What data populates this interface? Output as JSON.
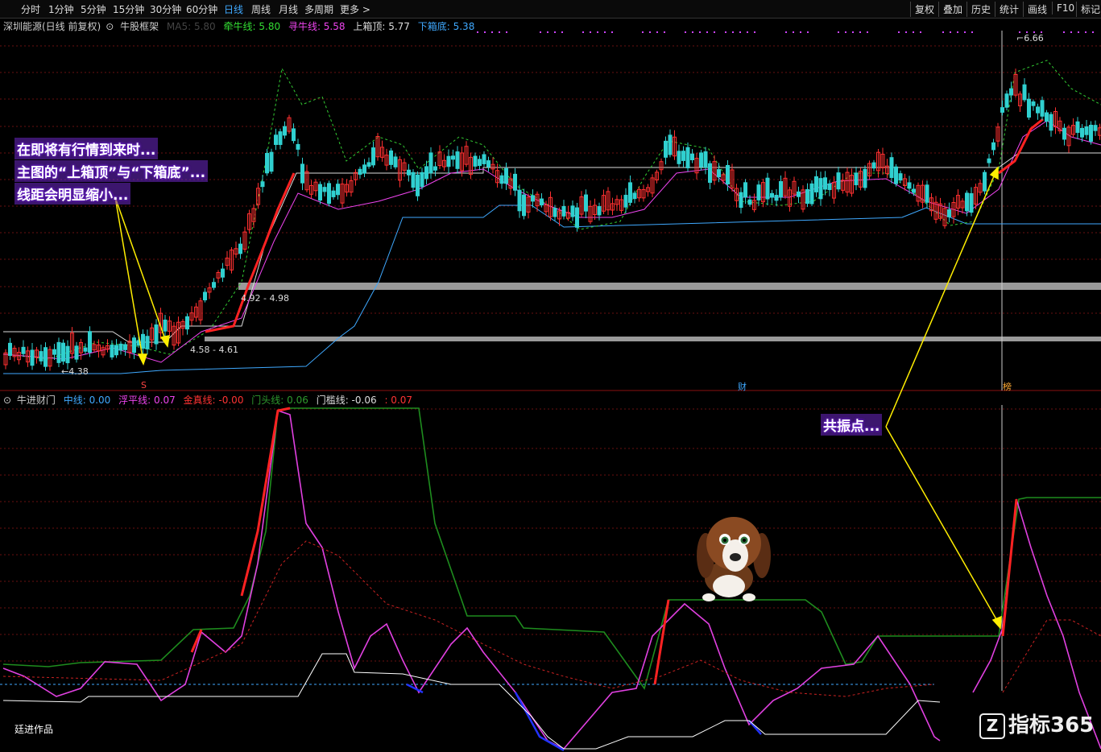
{
  "toolbar": {
    "periods": [
      "分时",
      "1分钟",
      "5分钟",
      "15分钟",
      "30分钟",
      "60分钟",
      "日线",
      "周线",
      "月线",
      "多周期",
      "更多 >"
    ],
    "active": "日线",
    "right": [
      "复权",
      "叠加",
      "历史",
      "统计",
      "画线",
      "F10",
      "标记"
    ]
  },
  "main_legend": {
    "stock": "深圳能源(日线 前复权)",
    "indicator": "牛股框架",
    "items": [
      {
        "label": "MA5: 5.80",
        "color": "#444444"
      },
      {
        "label": "牵牛线: 5.80",
        "color": "#33dd33"
      },
      {
        "label": "寻牛线: 5.58",
        "color": "#ee44ee"
      },
      {
        "label": "上箱顶: 5.77",
        "color": "#dddddd"
      },
      {
        "label": "下箱底: 5.38",
        "color": "#3fa9ff"
      }
    ]
  },
  "sub_legend": {
    "indicator": "牛进财门",
    "items": [
      {
        "label": "中线: 0.00",
        "color": "#3fa9ff"
      },
      {
        "label": "浮平线: 0.07",
        "color": "#ee44ee"
      },
      {
        "label": "金真线: -0.00",
        "color": "#ff3333"
      },
      {
        "label": "门头线: 0.06",
        "color": "#2e9a2e"
      },
      {
        "label": "门槛线: -0.06",
        "color": "#dddddd"
      },
      {
        "label": ": 0.07",
        "color": "#ff3333"
      }
    ]
  },
  "chart_labels": {
    "peak": "6.66",
    "low": "4.38",
    "zone_upper": "4.92 - 4.98",
    "zone_lower": "4.58 - 4.61",
    "marker_s": "S",
    "marker_cai": "财",
    "marker_bang": "榜"
  },
  "annotations": {
    "left_callout": [
      "在即将有行情到来时...",
      "主图的“上箱顶”与“下箱底”...",
      "线距会明显缩小..."
    ],
    "right_callout": "共振点...",
    "author": "廷进作品"
  },
  "brand": {
    "badge": "Z",
    "text": "指标365"
  }
}
